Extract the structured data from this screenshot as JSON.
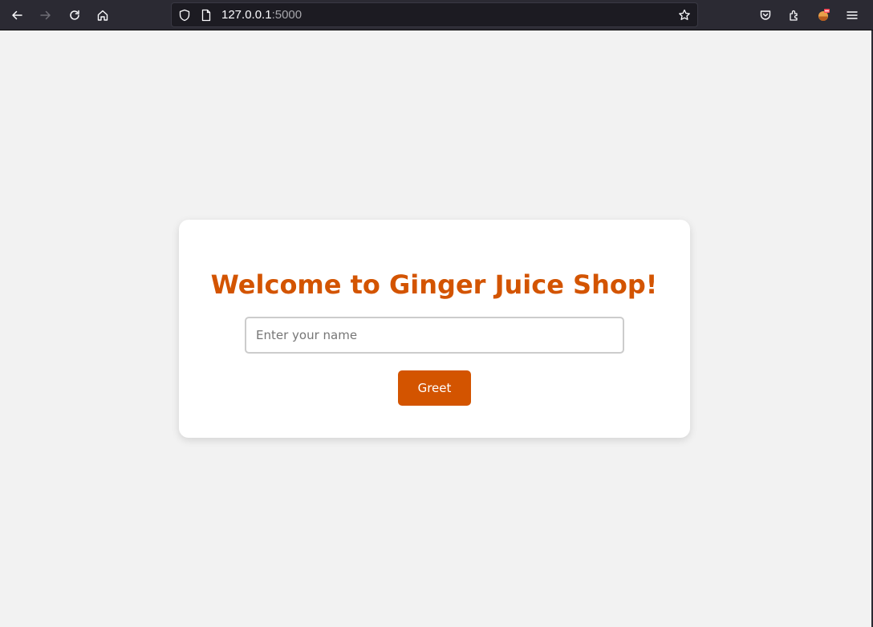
{
  "browser": {
    "url_host": "127.0.0.1",
    "url_port": ":5000",
    "toolbar_icons": [
      "back-arrow-icon",
      "forward-arrow-icon",
      "reload-icon",
      "home-icon",
      "shield-icon",
      "page-icon",
      "bookmark-star-icon",
      "pocket-icon",
      "extensions-icon",
      "profile-avatar-icon",
      "hamburger-menu-icon"
    ],
    "colors": {
      "toolbar_bg": "#2b2a33",
      "urlbar_bg": "#1c1b22"
    }
  },
  "page": {
    "title": "Welcome to Ginger Juice Shop!",
    "name_input": {
      "placeholder": "Enter your name",
      "value": ""
    },
    "greet_label": "Greet",
    "colors": {
      "accent": "#d35400",
      "background": "#f2f2f2",
      "card": "#ffffff"
    }
  }
}
